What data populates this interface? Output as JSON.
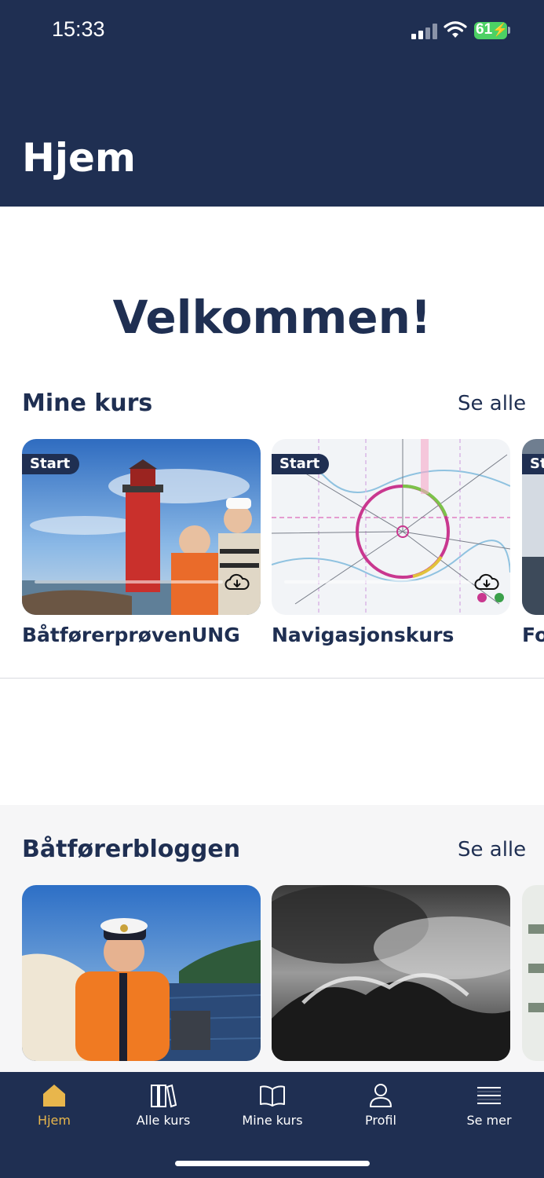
{
  "status_bar": {
    "time": "15:33",
    "battery": "61"
  },
  "header": {
    "title": "Hjem"
  },
  "welcome": "Velkommen!",
  "my_courses": {
    "title": "Mine kurs",
    "see_all": "Se alle",
    "chip_label": "Start",
    "items": [
      {
        "title": "BåtførerprøvenUNG"
      },
      {
        "title": "Navigasjonskurs"
      },
      {
        "title": "Fo"
      }
    ]
  },
  "blog": {
    "title": "Båtførerbloggen",
    "see_all": "Se alle"
  },
  "tabbar": {
    "active_color": "#e8b64c",
    "items": [
      {
        "label": "Hjem",
        "icon": "house-icon"
      },
      {
        "label": "Alle kurs",
        "icon": "books-icon"
      },
      {
        "label": "Mine kurs",
        "icon": "open-book-icon"
      },
      {
        "label": "Profil",
        "icon": "person-icon"
      },
      {
        "label": "Se mer",
        "icon": "menu-icon"
      }
    ]
  },
  "colors": {
    "primary": "#1f2f52",
    "accent": "#e8b64c",
    "battery": "#4cd164"
  }
}
